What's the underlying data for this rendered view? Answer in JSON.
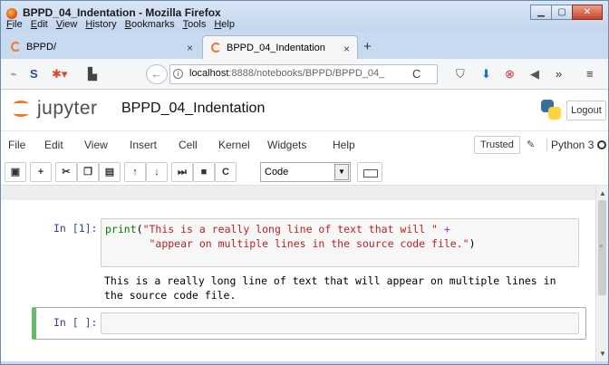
{
  "window": {
    "title": "BPPD_04_Indentation - Mozilla Firefox",
    "menu": [
      "File",
      "Edit",
      "View",
      "History",
      "Bookmarks",
      "Tools",
      "Help"
    ],
    "controls": [
      "minimize",
      "maximize",
      "close"
    ]
  },
  "tabs": [
    {
      "label": "BPPD/",
      "active": false
    },
    {
      "label": "BPPD_04_Indentation",
      "active": true
    }
  ],
  "navbar": {
    "url_host": "localhost",
    "url_path": ":8888/notebooks/BPPD/BPPD_04_"
  },
  "jupyter": {
    "brand": "jupyter",
    "notebook_name": "BPPD_04_Indentation",
    "logout_label": "Logout",
    "menu": [
      "File",
      "Edit",
      "View",
      "Insert",
      "Cell",
      "Kernel",
      "Widgets",
      "Help"
    ],
    "trusted_label": "Trusted",
    "kernel_name": "Python 3",
    "cell_type": "Code"
  },
  "cells": {
    "cell1_prompt": "In [1]:",
    "cell1_line1_fn": "print",
    "cell1_line1_str": "\"This is a really long line of text that will \"",
    "cell1_line1_op": "+",
    "cell1_line2_str": "\"appear on multiple lines in the source code file.\"",
    "output_line1": "This is a really long line of text that will appear on multiple lines in",
    "output_line2": "the source code file.",
    "cell2_prompt": "In [ ]:"
  },
  "colors": {
    "accent": "#f37726",
    "prompt": "#303f9f",
    "edit_mode": "#66bb6a"
  }
}
